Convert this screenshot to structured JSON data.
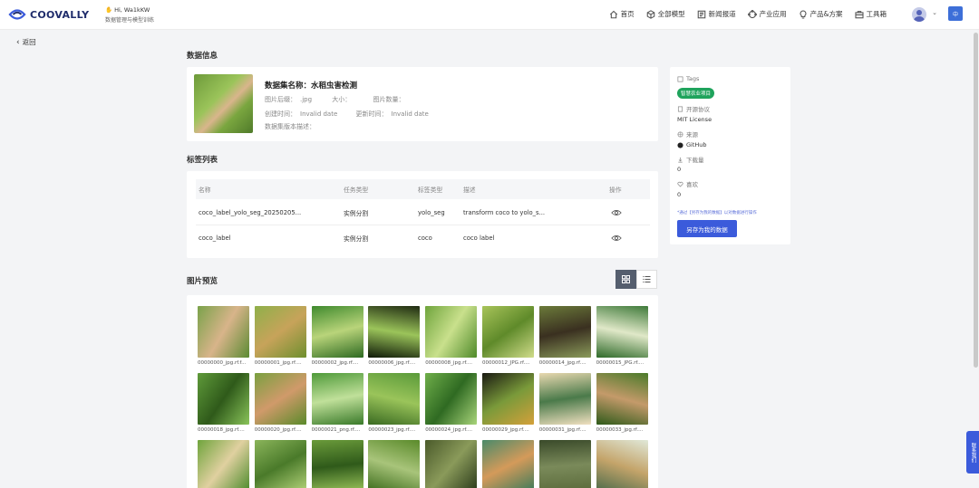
{
  "header": {
    "logo_text": "COOVALLY",
    "greeting": "Hi,  Wa1kKW",
    "greeting_sub": "数据管理与模型训练",
    "nav": [
      {
        "label": "首页",
        "icon": "home-icon"
      },
      {
        "label": "全部模型",
        "icon": "cube-icon"
      },
      {
        "label": "新闻报道",
        "icon": "news-icon"
      },
      {
        "label": "产业应用",
        "icon": "industry-icon"
      },
      {
        "label": "产品&方案",
        "icon": "bulb-icon"
      },
      {
        "label": "工具箱",
        "icon": "toolbox-icon"
      }
    ],
    "lang_label": "中"
  },
  "back_label": "返回",
  "dataset_info": {
    "section_title": "数据信息",
    "name_label": "数据集名称：水稻虫害检测",
    "suffix_label": "图片后缀：",
    "suffix_value": ".jpg",
    "size_label": "大小：",
    "count_label": "图片数量：",
    "created_label": "创建时间：",
    "created_value": "Invalid date",
    "updated_label": "更新时间：",
    "updated_value": "Invalid date",
    "version_label": "数据集版本描述："
  },
  "side_panel": {
    "tags_label": "Tags",
    "tag_value": "智慧农业项目",
    "license_label": "开源协议",
    "license_value": "MIT License",
    "source_label": "来源",
    "source_value": "GitHub",
    "downloads_label": "下载量",
    "downloads_value": "0",
    "likes_label": "喜欢",
    "likes_value": "0",
    "notice": "*通过【另存为我的数据】以对数据进行操作",
    "save_button": "另存为我的数据"
  },
  "label_list": {
    "section_title": "标签列表",
    "headers": [
      "名称",
      "任务类型",
      "标签类型",
      "描述",
      "操作"
    ],
    "rows": [
      {
        "name": "coco_label_yolo_seg_20250205...",
        "task": "实例分割",
        "label_type": "yolo_seg",
        "desc": "transform coco to yolo_s..."
      },
      {
        "name": "coco_label",
        "task": "实例分割",
        "label_type": "coco",
        "desc": "coco label"
      }
    ]
  },
  "preview": {
    "section_title": "图片预览",
    "images": [
      {
        "caption": "00000000_jpg.rf.f...",
        "c1": "#7aa24a",
        "c2": "#d8b48a",
        "c3": "#5b8a32"
      },
      {
        "caption": "00000001_jpg.rf....",
        "c1": "#8fb04a",
        "c2": "#c7a35a",
        "c3": "#6e8f2e"
      },
      {
        "caption": "00000002_jpg.rf....",
        "c1": "#3f8a2e",
        "c2": "#b9d47a",
        "c3": "#2e6a22"
      },
      {
        "caption": "00000006_jpg.rf....",
        "c1": "#1f2a12",
        "c2": "#9bc45a",
        "c3": "#0f1a08"
      },
      {
        "caption": "00000008_jpg.rf....",
        "c1": "#6fa43c",
        "c2": "#c9e08c",
        "c3": "#4f8a2a"
      },
      {
        "caption": "00000012_JPG.rf....",
        "c1": "#a8c45a",
        "c2": "#5f8a2a",
        "c3": "#d0dc8a"
      },
      {
        "caption": "00000014_jpg.rf....",
        "c1": "#6b7a3a",
        "c2": "#3a3020",
        "c3": "#8a9a5a"
      },
      {
        "caption": "00000015_JPG.rf....",
        "c1": "#3f7a3a",
        "c2": "#e0e8c8",
        "c3": "#2f6a2a"
      },
      {
        "caption": "00000018_jpg.rf....",
        "c1": "#5f9a3a",
        "c2": "#2f5a1a",
        "c3": "#8ac45a"
      },
      {
        "caption": "00000020_jpg.rf....",
        "c1": "#7aa040",
        "c2": "#d09a6a",
        "c3": "#5a8a2a"
      },
      {
        "caption": "00000021_png.rf....",
        "c1": "#4f9a3a",
        "c2": "#c0e09a",
        "c3": "#3a7a2a"
      },
      {
        "caption": "00000023_jpg.rf....",
        "c1": "#5a9a3a",
        "c2": "#9ac45a",
        "c3": "#3a6a22"
      },
      {
        "caption": "00000024_jpg.rf....",
        "c1": "#6fae4a",
        "c2": "#2f6a22",
        "c3": "#a8d47a"
      },
      {
        "caption": "00000029_jpg.rf....",
        "c1": "#1a1a12",
        "c2": "#7a9a3a",
        "c3": "#d4a03a"
      },
      {
        "caption": "00000031_jpg.rf....",
        "c1": "#e8d8b0",
        "c2": "#4a7a4a",
        "c3": "#f0e0c0"
      },
      {
        "caption": "00000033_jpg.rf....",
        "c1": "#4a7a2a",
        "c2": "#c49a6a",
        "c3": "#2f5a1a"
      },
      {
        "caption": "",
        "c1": "#6fa43c",
        "c2": "#e0d0a0",
        "c3": "#4a8a2a"
      },
      {
        "caption": "",
        "c1": "#8ab45a",
        "c2": "#4a7a2a",
        "c3": "#b4d47a"
      },
      {
        "caption": "",
        "c1": "#6a9a3a",
        "c2": "#2f5a1a",
        "c3": "#9ac45a"
      },
      {
        "caption": "",
        "c1": "#5a8a2a",
        "c2": "#a8c47a",
        "c3": "#3a6a1a"
      },
      {
        "caption": "",
        "c1": "#4a5a2a",
        "c2": "#8a9a5a",
        "c3": "#2a3a1a"
      },
      {
        "caption": "",
        "c1": "#4a8a6a",
        "c2": "#d49a5a",
        "c3": "#3a7a5a"
      },
      {
        "caption": "",
        "c1": "#3a4a2a",
        "c2": "#7a8a5a",
        "c3": "#5a6a3a"
      },
      {
        "caption": "",
        "c1": "#e0e8d8",
        "c2": "#c4a46a",
        "c3": "#4a6a4a"
      }
    ]
  },
  "contact_tab": "联系我们"
}
